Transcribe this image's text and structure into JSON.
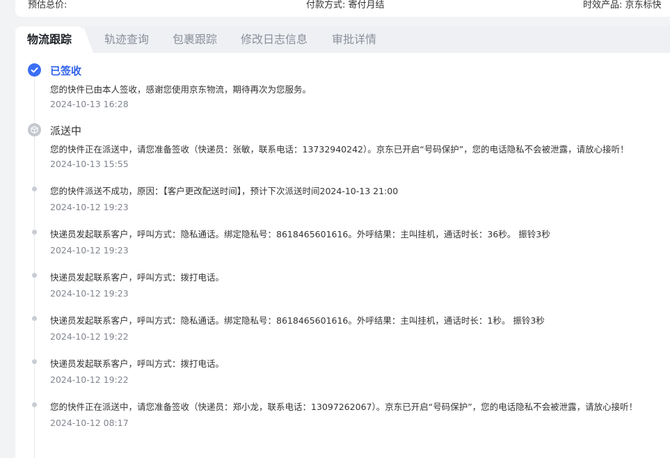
{
  "top_card": {
    "left_label": "预估总价:",
    "middle_label": "付款方式:",
    "middle_value": "寄付月结",
    "right_label": "时效产品:",
    "right_value": "京东标快"
  },
  "tabs": [
    {
      "label": "物流跟踪",
      "active": true
    },
    {
      "label": "轨迹查询",
      "active": false
    },
    {
      "label": "包裹跟踪",
      "active": false
    },
    {
      "label": "修改日志信息",
      "active": false
    },
    {
      "label": "审批详情",
      "active": false
    }
  ],
  "colors": {
    "accent": "#2f62e8",
    "muted": "#80858e"
  },
  "timeline": [
    {
      "status": "已签收",
      "icon": "check-circle-icon",
      "text": "您的快件已由本人签收，感谢您使用京东物流，期待再次为您服务。",
      "time": "2024-10-13 16:28"
    },
    {
      "status": "派送中",
      "icon": "delivery-box-icon",
      "text": "您的快件正在派送中，请您准备签收（快递员：张敏，联系电话：13732940242）。京东已开启“号码保护”，您的电话隐私不会被泄露，请放心接听！",
      "time": "2024-10-13 15:55"
    },
    {
      "status": "",
      "icon": "dot-icon",
      "text": "您的快件派送不成功，原因：【客户更改配送时间】，预计下次派送时间2024-10-13 21:00",
      "time": "2024-10-12 19:23"
    },
    {
      "status": "",
      "icon": "dot-icon",
      "text": "快递员发起联系客户，呼叫方式：隐私通话。绑定隐私号：8618465601616。外呼结果：主叫挂机，通话时长：36秒。 振铃3秒",
      "time": "2024-10-12 19:23"
    },
    {
      "status": "",
      "icon": "dot-icon",
      "text": "快递员发起联系客户，呼叫方式：拨打电话。",
      "time": "2024-10-12 19:23"
    },
    {
      "status": "",
      "icon": "dot-icon",
      "text": "快递员发起联系客户，呼叫方式：隐私通话。绑定隐私号：8618465601616。外呼结果：主叫挂机，通话时长：1秒。 振铃3秒",
      "time": "2024-10-12 19:22"
    },
    {
      "status": "",
      "icon": "dot-icon",
      "text": "快递员发起联系客户，呼叫方式：拨打电话。",
      "time": "2024-10-12 19:22"
    },
    {
      "status": "",
      "icon": "dot-icon",
      "text": "您的快件正在派送中，请您准备签收（快递员：郑小龙，联系电话：13097262067）。京东已开启“号码保护”，您的电话隐私不会被泄露，请放心接听！",
      "time": "2024-10-12 08:17"
    }
  ]
}
